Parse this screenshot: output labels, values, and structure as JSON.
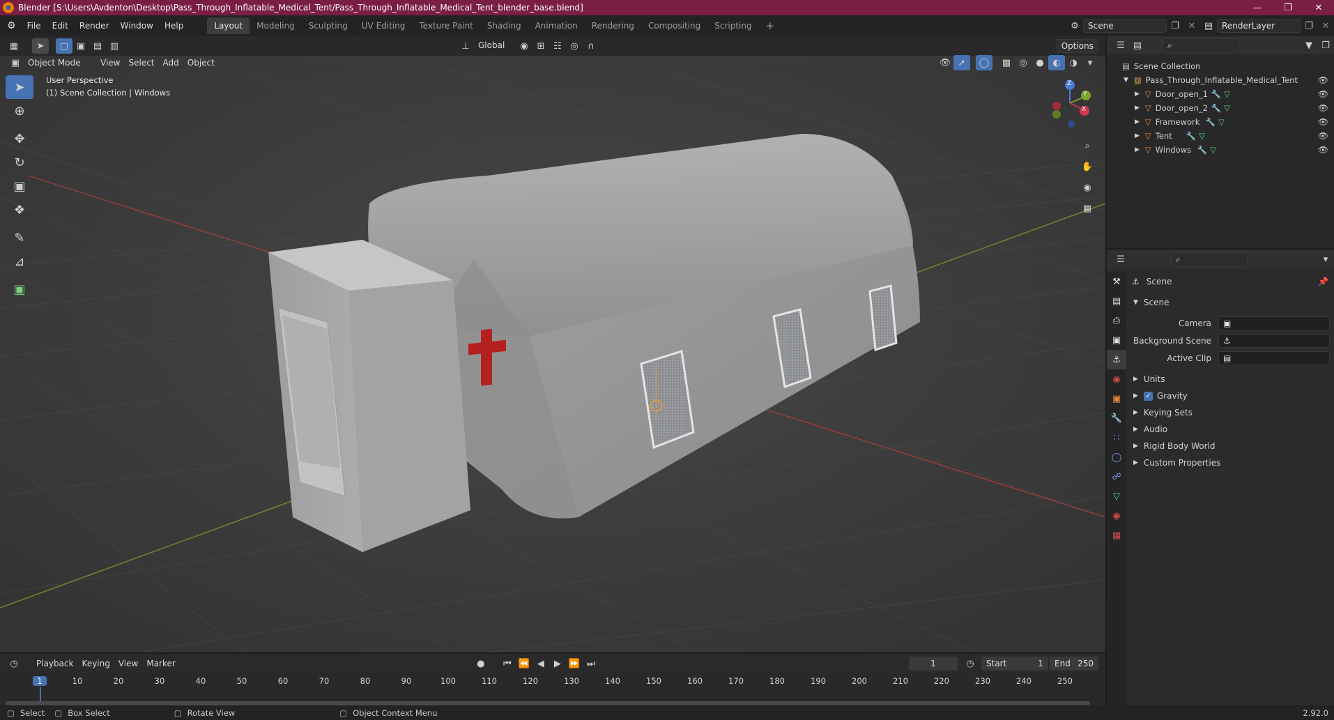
{
  "window": {
    "title": "Blender [S:\\Users\\Avdenton\\Desktop\\Pass_Through_Inflatable_Medical_Tent/Pass_Through_Inflatable_Medical_Tent_blender_base.blend]"
  },
  "menus": [
    "File",
    "Edit",
    "Render",
    "Window",
    "Help"
  ],
  "workspaces": [
    "Layout",
    "Modeling",
    "Sculpting",
    "UV Editing",
    "Texture Paint",
    "Shading",
    "Animation",
    "Rendering",
    "Compositing",
    "Scripting"
  ],
  "active_workspace": "Layout",
  "scene_name": "Scene",
  "render_layer": "RenderLayer",
  "viewport": {
    "mode": "Object Mode",
    "menus": [
      "View",
      "Select",
      "Add",
      "Object"
    ],
    "transform_orientation": "Global",
    "options_label": "Options",
    "overlay_title": "User Perspective",
    "overlay_subtitle": "(1) Scene Collection | Windows",
    "gizmo_axes": {
      "z": "Z",
      "y": "Y",
      "x": "X"
    }
  },
  "outliner": {
    "root": "Scene Collection",
    "collection": "Pass_Through_Inflatable_Medical_Tent",
    "objects": [
      "Door_open_1",
      "Door_open_2",
      "Framework",
      "Tent",
      "Windows"
    ]
  },
  "properties": {
    "context_title": "Scene",
    "panel_title": "Scene",
    "camera_label": "Camera",
    "background_scene_label": "Background Scene",
    "active_clip_label": "Active Clip",
    "collapsed_panels": [
      "Units",
      "Gravity",
      "Keying Sets",
      "Audio",
      "Rigid Body World",
      "Custom Properties"
    ],
    "gravity_checked": true
  },
  "timeline": {
    "menus": [
      "Playback",
      "Keying",
      "View",
      "Marker"
    ],
    "current_frame": "1",
    "start_label": "Start",
    "start_value": "1",
    "end_label": "End",
    "end_value": "250",
    "ruler": [
      "1",
      "10",
      "20",
      "30",
      "40",
      "50",
      "60",
      "70",
      "80",
      "90",
      "100",
      "110",
      "120",
      "130",
      "140",
      "150",
      "160",
      "170",
      "180",
      "190",
      "200",
      "210",
      "220",
      "230",
      "240",
      "250"
    ]
  },
  "statusbar": {
    "select": "Select",
    "box_select": "Box Select",
    "rotate_view": "Rotate View",
    "context_menu": "Object Context Menu",
    "version": "2.92.0"
  }
}
